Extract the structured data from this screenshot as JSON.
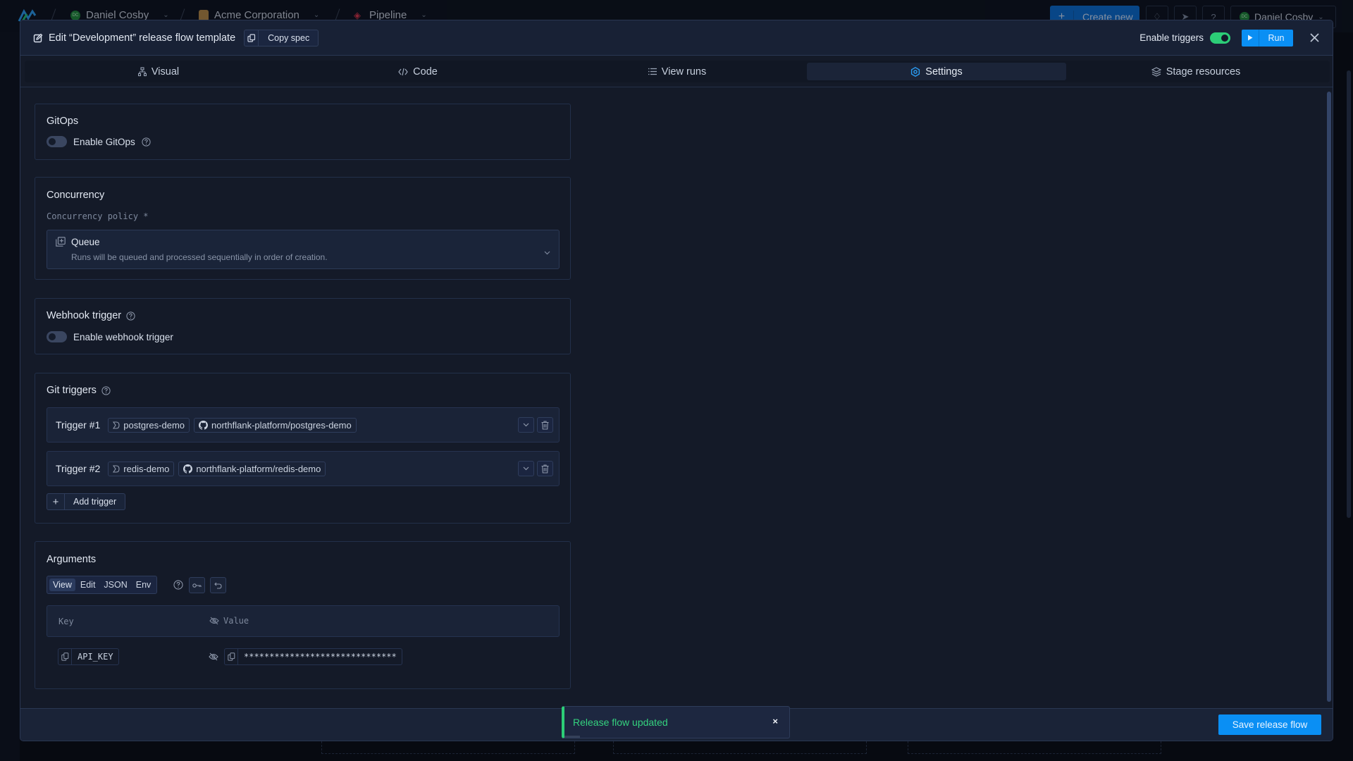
{
  "background": {
    "breadcrumbs": [
      {
        "label": "Daniel Cosby",
        "avatar": "DC"
      },
      {
        "label": "Acme Corporation"
      },
      {
        "label": "Pipeline"
      }
    ],
    "create_new_label": "Create new",
    "user": {
      "name": "Daniel Cosby",
      "avatar": "DC"
    }
  },
  "modal": {
    "title": "Edit “Development” release flow template",
    "copy_spec_label": "Copy spec",
    "enable_triggers_label": "Enable triggers",
    "enable_triggers_on": true,
    "run_label": "Run",
    "tabs": [
      {
        "label": "Visual",
        "icon": "sitemap-icon",
        "active": false
      },
      {
        "label": "Code",
        "icon": "code-icon",
        "active": false
      },
      {
        "label": "View runs",
        "icon": "list-icon",
        "active": false
      },
      {
        "label": "Settings",
        "icon": "gear-icon",
        "active": true
      },
      {
        "label": "Stage resources",
        "icon": "layers-icon",
        "active": false
      }
    ]
  },
  "gitops": {
    "title": "GitOps",
    "toggle_label": "Enable GitOps",
    "enabled": false
  },
  "concurrency": {
    "title": "Concurrency",
    "policy_label": "Concurrency policy *",
    "selected": {
      "label": "Queue",
      "description": "Runs will be queued and processed sequentially in order of creation."
    }
  },
  "webhook": {
    "title": "Webhook trigger",
    "toggle_label": "Enable webhook trigger",
    "enabled": false
  },
  "git_triggers": {
    "title": "Git triggers",
    "triggers": [
      {
        "name": "Trigger #1",
        "branch": "postgres-demo",
        "repo": "northflank-platform/postgres-demo"
      },
      {
        "name": "Trigger #2",
        "branch": "redis-demo",
        "repo": "northflank-platform/redis-demo"
      }
    ],
    "add_label": "Add trigger"
  },
  "arguments": {
    "title": "Arguments",
    "modes": [
      "View",
      "Edit",
      "JSON",
      "Env"
    ],
    "active_mode": "View",
    "columns": {
      "key": "Key",
      "value": "Value"
    },
    "rows": [
      {
        "key": "API_KEY",
        "value": "******************************"
      }
    ]
  },
  "footer": {
    "save_label": "Save release flow"
  },
  "toast": {
    "message": "Release flow updated",
    "close": "×"
  },
  "colors": {
    "accent": "#0a8ff4",
    "success": "#2ccd77",
    "background": "#141a28"
  }
}
